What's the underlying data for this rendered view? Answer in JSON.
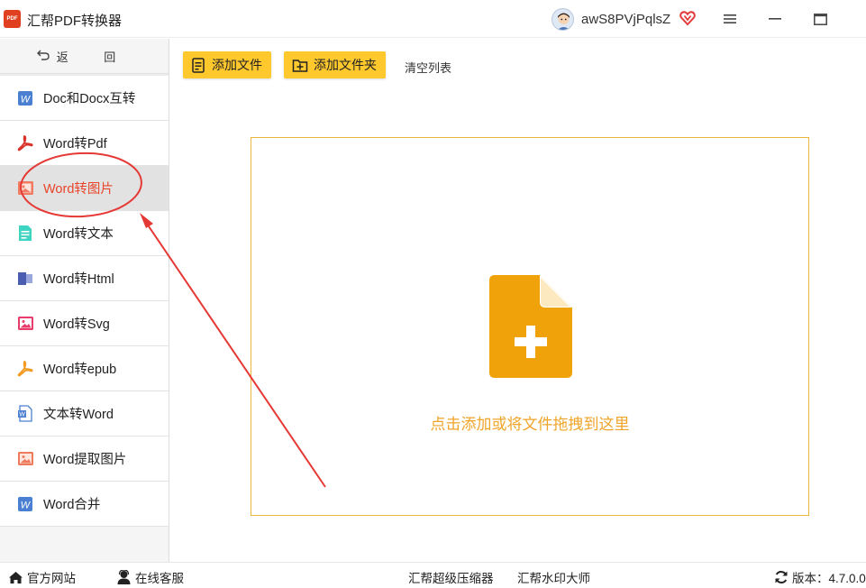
{
  "titlebar": {
    "app_title": "汇帮PDF转换器",
    "logo_text": "PDF",
    "username": "awS8PVjPqlsZ",
    "icons": [
      "avatar",
      "vip-heart-icon",
      "menu-icon",
      "minimize-icon",
      "maximize-icon"
    ]
  },
  "sidebar": {
    "back_label": "返 回",
    "items": [
      {
        "label": "Doc和Docx互转",
        "icon": "word-doc-icon"
      },
      {
        "label": "Word转Pdf",
        "icon": "pdf-icon"
      },
      {
        "label": "Word转图片",
        "icon": "image-icon",
        "active": true
      },
      {
        "label": "Word转文本",
        "icon": "text-file-icon"
      },
      {
        "label": "Word转Html",
        "icon": "html-icon"
      },
      {
        "label": "Word转Svg",
        "icon": "svg-image-icon"
      },
      {
        "label": "Word转epub",
        "icon": "epub-icon"
      },
      {
        "label": "文本转Word",
        "icon": "word-file-icon"
      },
      {
        "label": "Word提取图片",
        "icon": "extract-image-icon"
      },
      {
        "label": "Word合并",
        "icon": "merge-icon"
      }
    ]
  },
  "toolbar": {
    "add_file": "添加文件",
    "add_folder": "添加文件夹",
    "clear_list": "清空列表"
  },
  "dropzone": {
    "hint": "点击添加或将文件拖拽到这里"
  },
  "statusbar": {
    "website": "官方网站",
    "support": "在线客服",
    "compressor": "汇帮超级压缩器",
    "watermark": "汇帮水印大师",
    "version": "版本：4.7.0.0"
  },
  "colors": {
    "accent_yellow": "#ffc82c",
    "active_red": "#e8452a",
    "drop_orange": "#efa42a",
    "annotation_red": "#e53935"
  }
}
